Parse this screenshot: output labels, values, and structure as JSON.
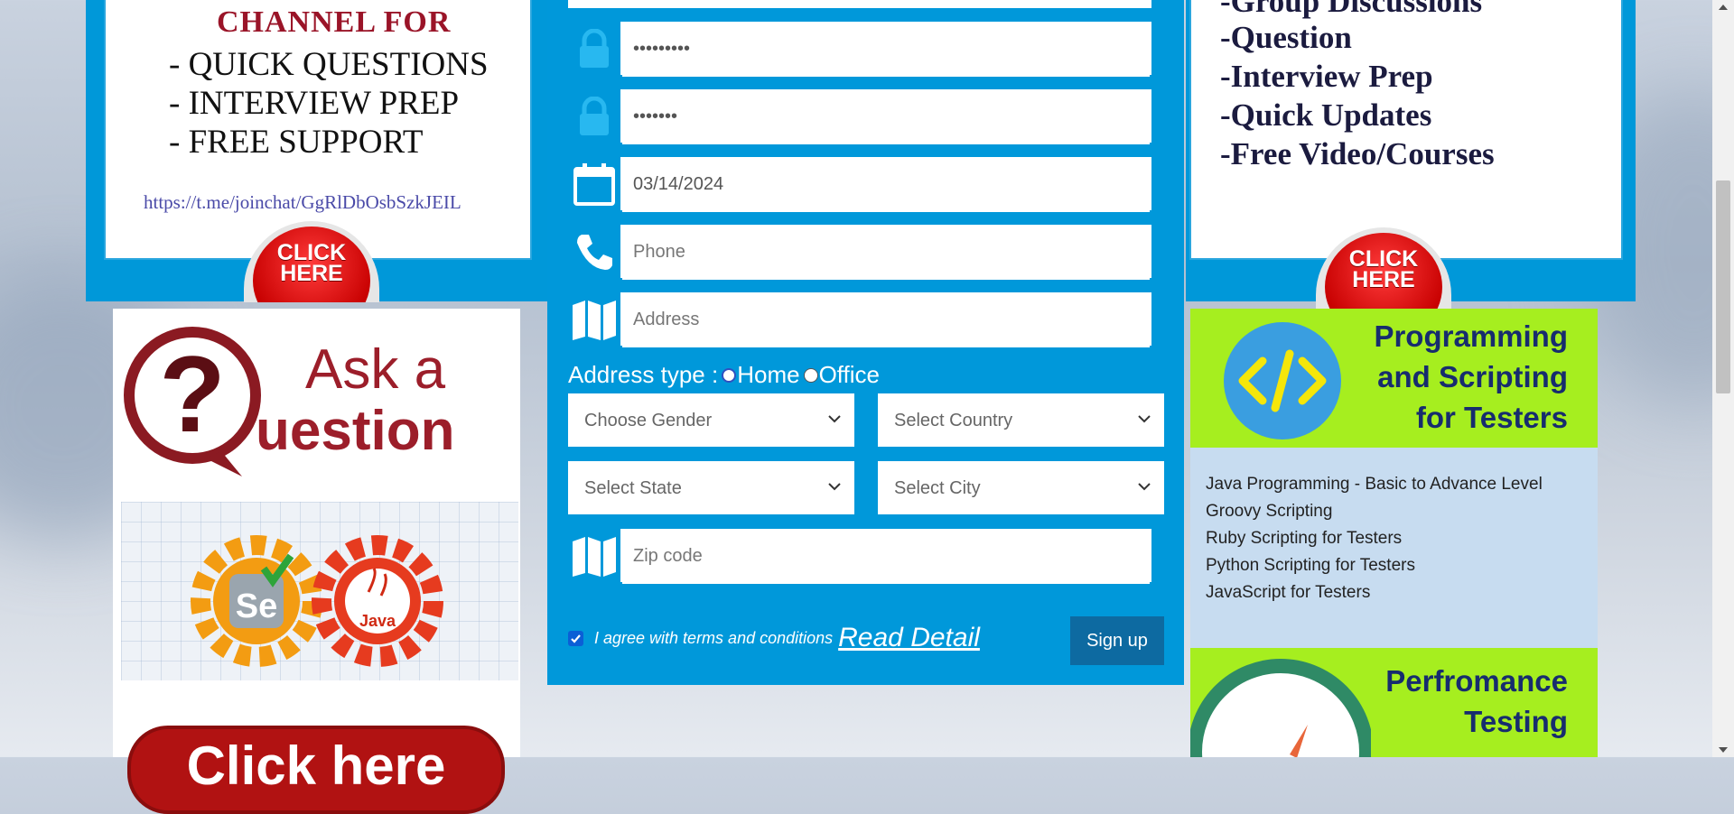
{
  "left_banner": {
    "title": "CHANNEL  FOR",
    "lines": [
      "- QUICK QUESTIONS",
      "- INTERVIEW PREP",
      "- FREE SUPPORT"
    ],
    "url": "https://t.me/joinchat/GgRlDbOsbSzkJEIL",
    "click_line1": "CLICK",
    "click_line2": "HERE"
  },
  "right_banner": {
    "lines": [
      "-Group Discussions",
      "-Question",
      "-Interview Prep",
      "-Quick Updates",
      "-Free Video/Courses"
    ],
    "click_line1": "CLICK",
    "click_line2": "HERE"
  },
  "ask_question": {
    "word1": "Ask a",
    "word2": "uestion"
  },
  "gears": {
    "left_label": "Se",
    "right_label": "Java"
  },
  "click_here_big": "Click here",
  "form": {
    "password_value": "•••••••••",
    "confirm_password_value": "•••••••",
    "date_value": "03/14/2024",
    "phone_placeholder": "Phone",
    "address_placeholder": "Address",
    "address_type_label": "Address type :",
    "address_type_options": [
      "Home",
      "Office"
    ],
    "gender_select": "Choose Gender",
    "country_select": "Select Country",
    "state_select": "Select State",
    "city_select": "Select City",
    "zip_placeholder": "Zip code",
    "terms_text": "I agree with terms and conditions",
    "read_detail": "Read Detail",
    "signup_label": "Sign up"
  },
  "programming_ad": {
    "title_lines": [
      "Programming",
      "and Scripting",
      "for Testers"
    ],
    "items": [
      "Java Programming - Basic to Advance Level",
      "Groovy Scripting",
      "Ruby Scripting for Testers",
      "Python Scripting for Testers",
      "JavaScript for Testers"
    ]
  },
  "performance_ad": {
    "title_lines": [
      "Perfromance",
      "Testing"
    ]
  },
  "colors": {
    "form_blue": "#0098da",
    "signup_blue": "#0d6aa1",
    "lime": "#a6ee1f",
    "navy": "#172c6e"
  }
}
